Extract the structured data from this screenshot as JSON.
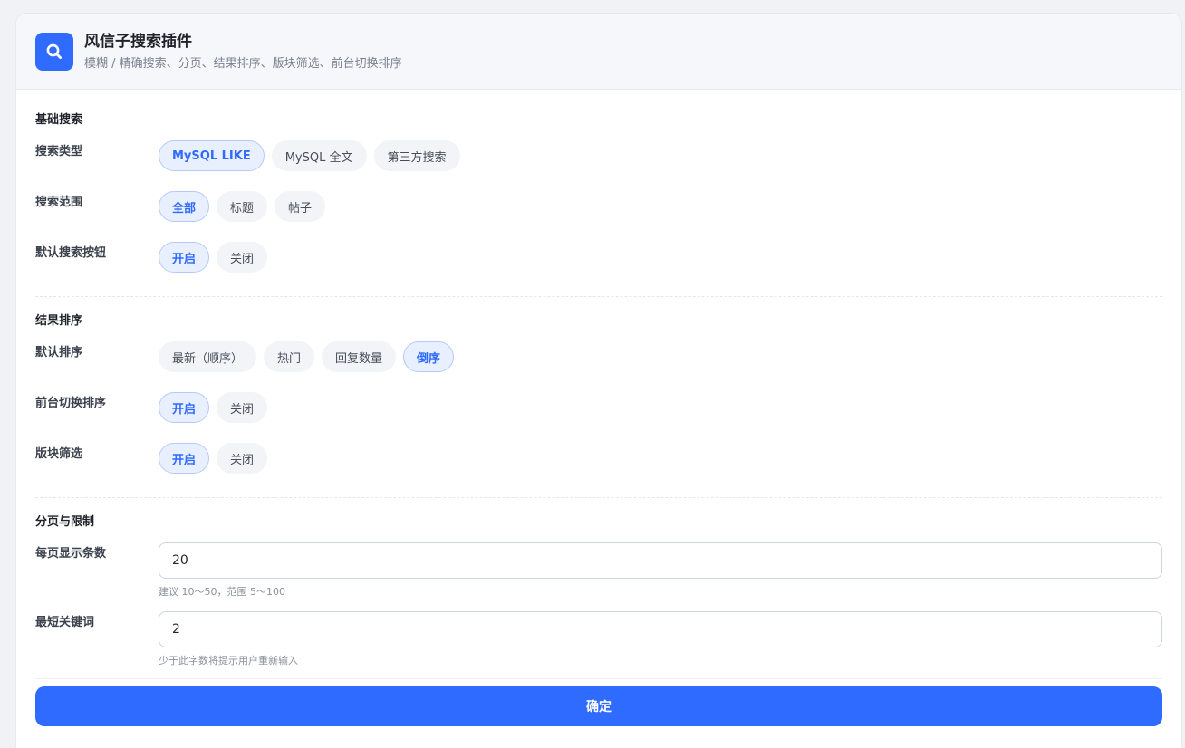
{
  "header": {
    "icon": "search-icon",
    "title": "风信子搜索插件",
    "subtitle": "模糊 / 精确搜索、分页、结果排序、版块筛选、前台切换排序"
  },
  "colors": {
    "accent": "#2f6bff",
    "active_bg": "#e8efff",
    "pill_bg": "#f3f4f7"
  },
  "basic": {
    "title": "基础搜索",
    "search_type": {
      "label": "搜索类型",
      "options": [
        "MySQL LIKE",
        "MySQL 全文",
        "第三方搜索"
      ],
      "selected": 0
    },
    "search_scope": {
      "label": "搜索范围",
      "options": [
        "全部",
        "标题",
        "帖子"
      ],
      "selected": 0
    },
    "default_button": {
      "label": "默认搜索按钮",
      "options": [
        "开启",
        "关闭"
      ],
      "selected": 0
    }
  },
  "sorting": {
    "title": "结果排序",
    "default_sort": {
      "label": "默认排序",
      "options": [
        "最新（顺序）",
        "热门",
        "回复数量",
        "倒序"
      ],
      "selected": 3
    },
    "frontend_switch": {
      "label": "前台切换排序",
      "options": [
        "开启",
        "关闭"
      ],
      "selected": 0
    },
    "forum_filter": {
      "label": "版块筛选",
      "options": [
        "开启",
        "关闭"
      ],
      "selected": 0
    }
  },
  "paging": {
    "title": "分页与限制",
    "per_page": {
      "label": "每页显示条数",
      "value": "20",
      "hint": "建议 10～50，范围 5～100"
    },
    "min_keyword": {
      "label": "最短关键词",
      "value": "2",
      "hint": "少于此字数将提示用户重新输入"
    }
  },
  "submit": {
    "label": "确定"
  }
}
